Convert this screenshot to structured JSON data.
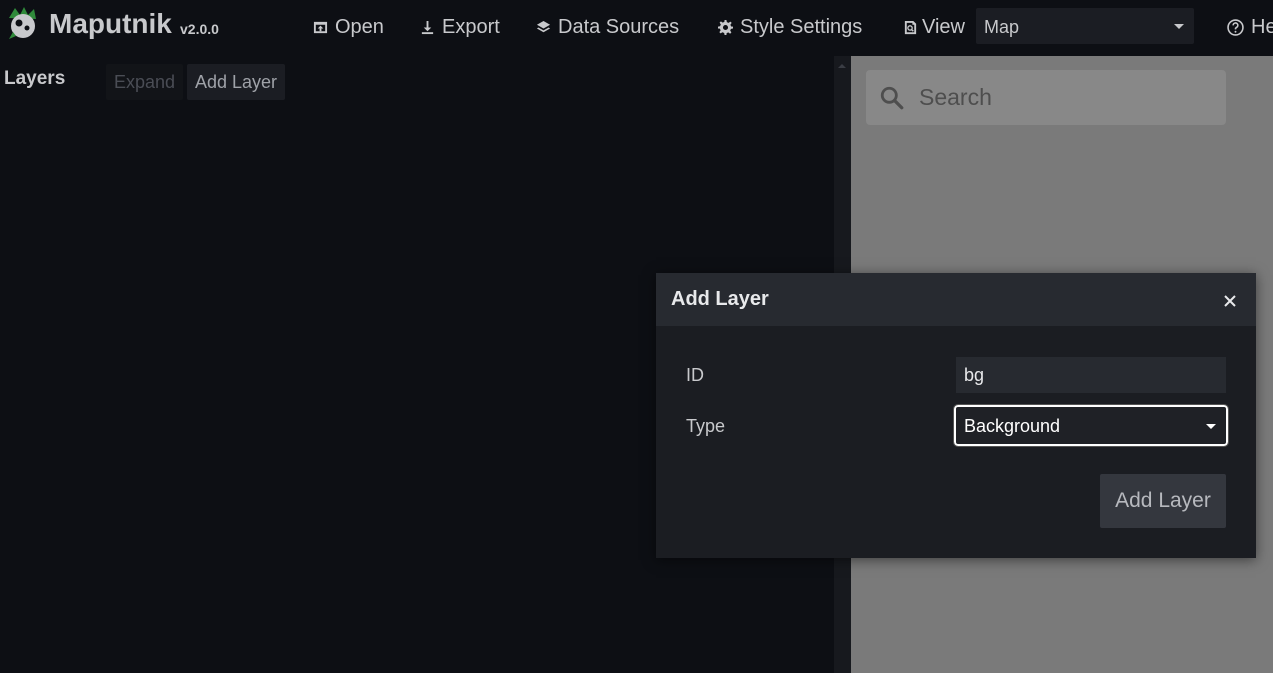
{
  "app": {
    "name": "Maputnik",
    "version": "v2.0.0",
    "logo_icon": "maputnik-logo"
  },
  "toolbar": {
    "open_label": "Open",
    "export_label": "Export",
    "data_sources_label": "Data Sources",
    "style_settings_label": "Style Settings",
    "view_label": "View",
    "view_selected": "Map",
    "help_label": "He"
  },
  "layer_panel": {
    "title": "Layers",
    "expand_label": "Expand",
    "add_layer_label": "Add Layer"
  },
  "map": {
    "search_placeholder": "Search"
  },
  "modal": {
    "title": "Add Layer",
    "id_label": "ID",
    "id_value": "bg",
    "type_label": "Type",
    "type_selected": "Background",
    "submit_label": "Add Layer"
  },
  "colors": {
    "background": "#0d0f14",
    "modal": "#1b1d22",
    "modal_header": "#272a30",
    "map": "#7a7a7a"
  }
}
